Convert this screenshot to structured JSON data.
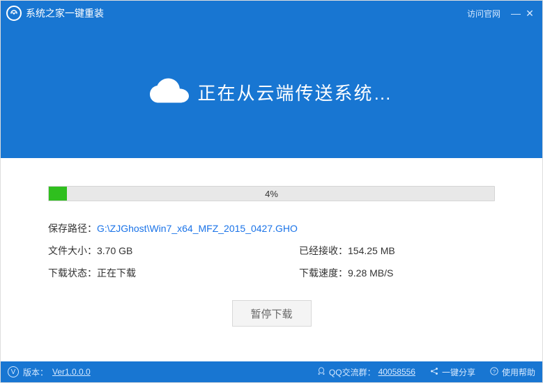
{
  "titlebar": {
    "title": "系统之家一键重装",
    "visit_site": "访问官网"
  },
  "hero": {
    "text": "正在从云端传送系统…"
  },
  "progress": {
    "percent": 4,
    "label": "4%"
  },
  "info": {
    "save_path_label": "保存路径：",
    "save_path_value": "G:\\ZJGhost\\Win7_x64_MFZ_2015_0427.GHO",
    "file_size_label": "文件大小：",
    "file_size_value": "3.70 GB",
    "received_label": "已经接收：",
    "received_value": "154.25 MB",
    "status_label": "下载状态：",
    "status_value": "正在下载",
    "speed_label": "下载速度：",
    "speed_value": "9.28 MB/S"
  },
  "buttons": {
    "pause": "暂停下载"
  },
  "footer": {
    "version_label": "版本：",
    "version_value": "Ver1.0.0.0",
    "qq_label": "QQ交流群：",
    "qq_value": "40058556",
    "share": "一键分享",
    "help": "使用帮助"
  }
}
